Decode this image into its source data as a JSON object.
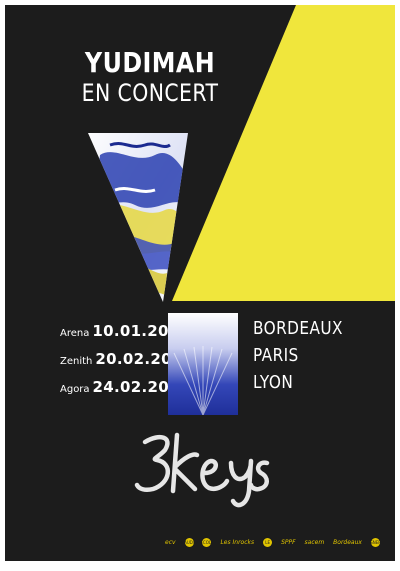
{
  "poster": {
    "artist": "YUDIMAH",
    "subtitle": "EN CONCERT",
    "dates": [
      {
        "venue": "Arena",
        "date": "10.01.20"
      },
      {
        "venue": "Zenith",
        "date": "20.02.20"
      },
      {
        "venue": "Agora",
        "date": "24.02.20"
      }
    ],
    "cities": [
      "BORDEAUX",
      "PARIS",
      "LYON"
    ],
    "brand": "3keys",
    "sponsors": [
      "ecv",
      "BEAUDUM",
      "ECOLE",
      "Les Inrocks",
      "LE",
      "SPPF",
      "sacem",
      "Bordeaux",
      "SNEP"
    ]
  },
  "colors": {
    "background": "#1c1c1c",
    "accent_yellow": "#f0e63c",
    "ink_blue": "#2a3fb0",
    "text": "#ffffff"
  }
}
